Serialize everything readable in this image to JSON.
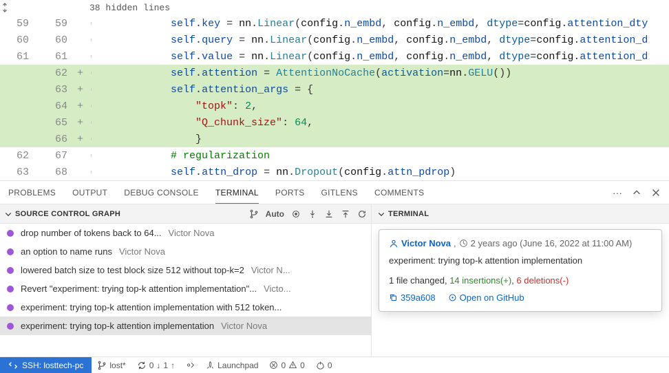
{
  "fold": {
    "label": "38 hidden lines"
  },
  "code_lines": [
    {
      "old": "59",
      "new": "59",
      "added": false,
      "indent": "            ",
      "html": "<span class='kw-self'>self</span>.<span class='attr'>key</span> = <span class='ident'>nn</span>.<span class='cls'>Linear</span>(<span class='ident'>config</span>.<span class='attr'>n_embd</span>, <span class='ident'>config</span>.<span class='attr'>n_embd</span>, <span class='param'>dtype</span>=<span class='ident'>config</span>.<span class='attr'>attention_dty</span>"
    },
    {
      "old": "60",
      "new": "60",
      "added": false,
      "indent": "            ",
      "html": "<span class='kw-self'>self</span>.<span class='attr'>query</span> = <span class='ident'>nn</span>.<span class='cls'>Linear</span>(<span class='ident'>config</span>.<span class='attr'>n_embd</span>, <span class='ident'>config</span>.<span class='attr'>n_embd</span>, <span class='param'>dtype</span>=<span class='ident'>config</span>.<span class='attr'>attention_d</span>"
    },
    {
      "old": "61",
      "new": "61",
      "added": false,
      "indent": "            ",
      "html": "<span class='kw-self'>self</span>.<span class='attr'>value</span> = <span class='ident'>nn</span>.<span class='cls'>Linear</span>(<span class='ident'>config</span>.<span class='attr'>n_embd</span>, <span class='ident'>config</span>.<span class='attr'>n_embd</span>, <span class='param'>dtype</span>=<span class='ident'>config</span>.<span class='attr'>attention_d</span>"
    },
    {
      "old": "",
      "new": "62",
      "added": true,
      "indent": "            ",
      "html": "<span class='kw-self'>self</span>.<span class='attr'>attention</span> = <span class='cls'>AttentionNoCache</span>(<span class='param'>activation</span>=<span class='ident'>nn</span>.<span class='cls'>GELU</span>())"
    },
    {
      "old": "",
      "new": "63",
      "added": true,
      "indent": "            ",
      "html": "<span class='kw-self'>self</span>.<span class='attr'>attention_args</span> = {"
    },
    {
      "old": "",
      "new": "64",
      "added": true,
      "indent": "                ",
      "html": "<span class='str'>\"topk\"</span>: <span class='num'>2</span>,"
    },
    {
      "old": "",
      "new": "65",
      "added": true,
      "indent": "                ",
      "html": "<span class='str'>\"Q_chunk_size\"</span>: <span class='num'>64</span>,"
    },
    {
      "old": "",
      "new": "66",
      "added": true,
      "indent": "                ",
      "html": "}"
    },
    {
      "old": "62",
      "new": "67",
      "added": false,
      "indent": "            ",
      "html": "<span class='cmt'># regularization</span>"
    },
    {
      "old": "63",
      "new": "68",
      "added": false,
      "indent": "            ",
      "html": "<span class='kw-self'>self</span>.<span class='attr'>attn_drop</span> = <span class='ident'>nn</span>.<span class='cls'>Dropout</span>(<span class='ident'>config</span>.<span class='attr'>attn_pdrop</span>)"
    }
  ],
  "panel_tabs": {
    "problems": "PROBLEMS",
    "output": "OUTPUT",
    "debug": "DEBUG CONSOLE",
    "terminal": "TERMINAL",
    "ports": "PORTS",
    "gitlens": "GITLENS",
    "comments": "COMMENTS"
  },
  "scg": {
    "title": "SOURCE CONTROL GRAPH",
    "auto": "Auto",
    "commits": [
      {
        "msg": "drop number of tokens back to 64...",
        "author": "Victor Nova"
      },
      {
        "msg": "an option to name runs",
        "author": "Victor Nova"
      },
      {
        "msg": "lowered batch size to test block size 512 without top-k=2",
        "author": "Victor N..."
      },
      {
        "msg": "Revert \"experiment: trying top-k attention implementation\"...",
        "author": "Victo..."
      },
      {
        "msg": "experiment: trying top-k attention implementation with 512 token...",
        "author": ""
      },
      {
        "msg": "experiment: trying top-k attention implementation",
        "author": "Victor Nova"
      }
    ]
  },
  "terminal_title": "TERMINAL",
  "hover": {
    "user": "Victor Nova",
    "when": "2 years ago (June 16, 2022 at 11:00 AM)",
    "message": "experiment: trying top-k attention implementation",
    "files": "1 file changed,",
    "insertions": "14 insertions(+)",
    "deletions": "6 deletions(-)",
    "sha": "359a608",
    "open_label": "Open on GitHub"
  },
  "statusbar": {
    "remote": "SSH: losttech-pc",
    "branch": "lost*",
    "sync_down": "0",
    "sync_up": "1",
    "launchpad": "Launchpad",
    "errors": "0",
    "warnings": "0",
    "ports": "0"
  }
}
